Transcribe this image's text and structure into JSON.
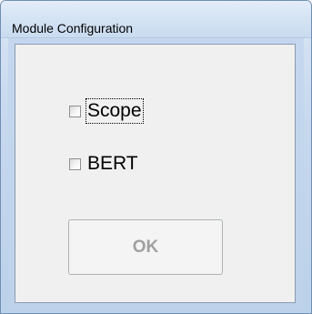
{
  "window": {
    "title": "Module Configuration"
  },
  "options": [
    {
      "label": "Scope",
      "checked": false,
      "focused": true
    },
    {
      "label": "BERT",
      "checked": false,
      "focused": false
    }
  ],
  "ok_button": {
    "label": "OK",
    "enabled": false
  }
}
